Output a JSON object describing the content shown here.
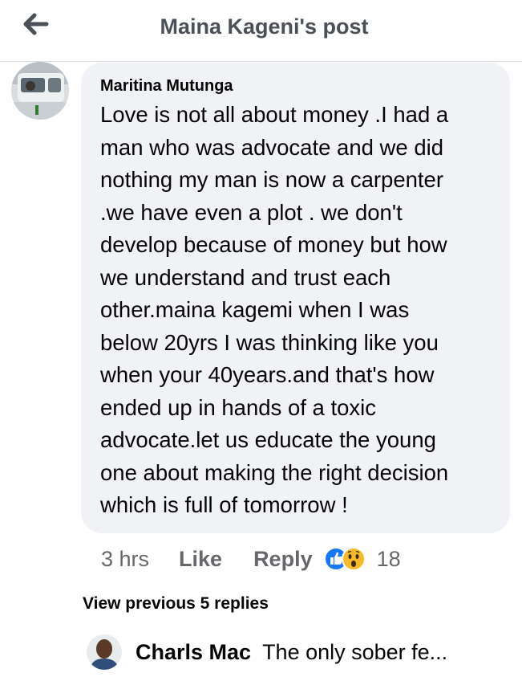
{
  "header": {
    "title": "Maina Kageni's post",
    "back_icon": "arrow-left-icon"
  },
  "comment": {
    "author": "Maritina Mutunga",
    "text": "Love is not all about money .I had a\nman who was advocate and we did\nnothing my man is now a carpenter\n.we have even a plot  . we don't\ndevelop because of money but how\nwe understand and trust each\nother.maina kagemi when I was\nbelow 20yrs I was thinking like you\nwhen your 40years.and that's how\nended up in hands of a toxic\nadvocate.let us educate the young\none about making the right decision\nwhich is full of tomorrow !",
    "time": "3 hrs",
    "like_label": "Like",
    "reply_label": "Reply",
    "reaction_icons": [
      "like-reaction-icon",
      "wow-reaction-icon"
    ],
    "reaction_count": "18"
  },
  "replies": {
    "view_previous_label": "View previous 5 replies",
    "latest": {
      "author": "Charls Mac",
      "snippet": "The only sober fe..."
    }
  },
  "colors": {
    "bubble": "#f0f2f5",
    "meta_text": "#65676b",
    "like_blue": "#1877f2",
    "wow_yellow": "#f7b928"
  }
}
